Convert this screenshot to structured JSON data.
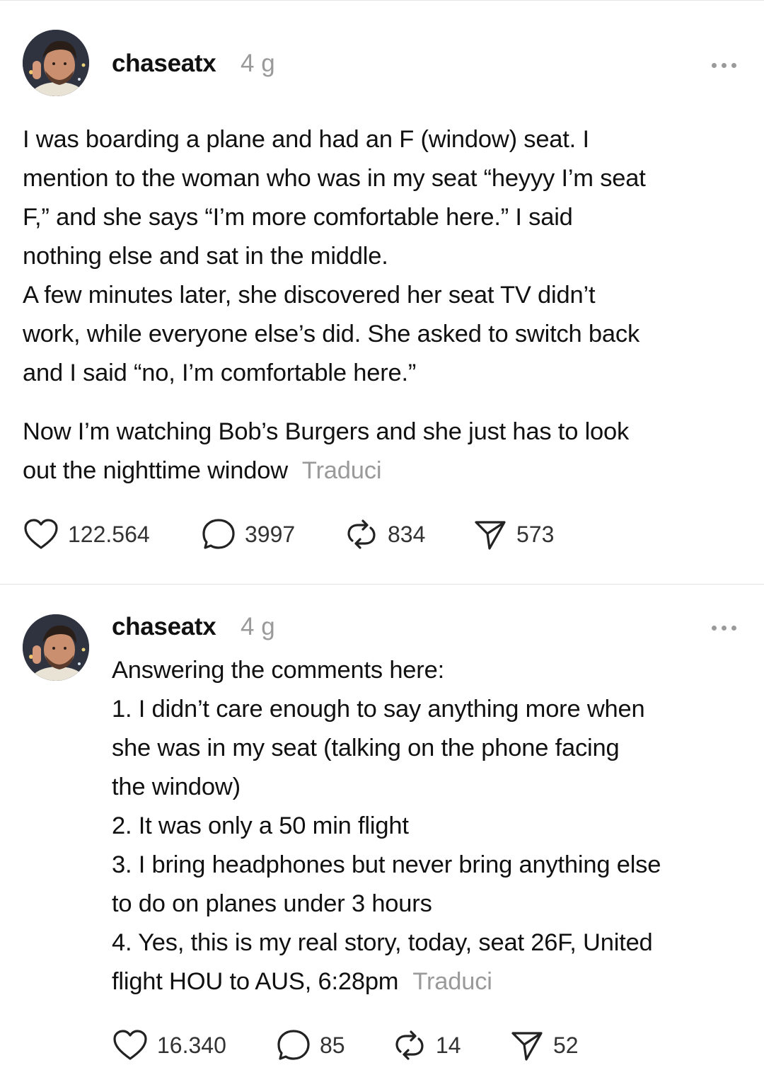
{
  "posts": [
    {
      "username": "chaseatx",
      "time": "4 g",
      "lines": [
        "I was boarding a plane and had an F (window) seat. I",
        "mention to the woman who was in my seat “heyyy I’m seat",
        "F,” and she says “I’m more comfortable here.” I said",
        "nothing else and sat in the middle.",
        "A few minutes later, she discovered her seat TV didn’t",
        "work, while everyone else’s did. She asked to switch back",
        "and I said “no, I’m comfortable here.”"
      ],
      "lines2": [
        "Now I’m watching Bob’s Burgers and she just has to look",
        "out the nighttime window"
      ],
      "translate_label": "Traduci",
      "likes": "122.564",
      "comments": "3997",
      "reposts": "834",
      "shares": "573"
    },
    {
      "username": "chaseatx",
      "time": "4 g",
      "lines": [
        "Answering the comments here:",
        "1. I didn’t care enough to say anything more when",
        "she was in my seat (talking on the phone facing",
        "the window)",
        "2. It was only a 50 min flight",
        "3. I bring headphones but never bring anything else",
        "to do on planes under 3 hours",
        "4. Yes, this is my real story, today, seat 26F, United",
        "flight HOU to AUS, 6:28pm"
      ],
      "translate_label": "Traduci",
      "likes": "16.340",
      "comments": "85",
      "reposts": "14",
      "shares": "52"
    }
  ]
}
